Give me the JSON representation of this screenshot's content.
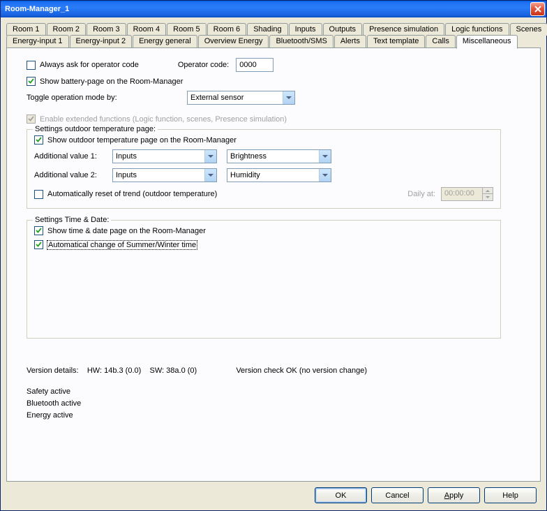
{
  "window": {
    "title": "Room-Manager_1"
  },
  "tabs_row1": [
    {
      "label": "Room 1"
    },
    {
      "label": "Room 2"
    },
    {
      "label": "Room 3"
    },
    {
      "label": "Room 4"
    },
    {
      "label": "Room 5"
    },
    {
      "label": "Room 6"
    },
    {
      "label": "Shading"
    },
    {
      "label": "Inputs"
    },
    {
      "label": "Outputs"
    },
    {
      "label": "Presence simulation"
    },
    {
      "label": "Logic functions"
    },
    {
      "label": "Scenes"
    }
  ],
  "tabs_row2": [
    {
      "label": "Energy-input 1"
    },
    {
      "label": "Energy-input 2"
    },
    {
      "label": "Energy general"
    },
    {
      "label": "Overview Energy"
    },
    {
      "label": "Bluetooth/SMS"
    },
    {
      "label": "Alerts"
    },
    {
      "label": "Text template"
    },
    {
      "label": "Calls"
    },
    {
      "label": "Miscellaneous",
      "active": true
    }
  ],
  "misc": {
    "always_ask_label": "Always ask for operator code",
    "operator_code_label": "Operator code:",
    "operator_code_value": "0000",
    "show_battery_label": "Show battery-page on the Room-Manager",
    "toggle_mode_label": "Toggle operation mode by:",
    "toggle_mode_value": "External sensor",
    "enable_ext_label": "Enable extended functions (Logic function, scenes, Presence simulation)"
  },
  "outdoor": {
    "legend": "Settings outdoor temperature page:",
    "show_label": "Show outdoor temperature page on the Room-Manager",
    "add1_label": "Additional value 1:",
    "add1_src": "Inputs",
    "add1_val": "Brightness",
    "add2_label": "Additional value 2:",
    "add2_src": "Inputs",
    "add2_val": "Humidity",
    "auto_reset_label": "Automatically reset of trend (outdoor temperature)",
    "daily_at_label": "Daily at:",
    "daily_at_value": "00:00:00"
  },
  "timedate": {
    "legend": "Settings Time & Date:",
    "show_label": "Show time & date page on the Room-Manager",
    "auto_summer_label": "Automatical change of Summer/Winter time"
  },
  "status": {
    "version_label": "Version details:",
    "hw": "HW: 14b.3 (0.0)",
    "sw": "SW: 38a.0 (0)",
    "check": "Version check OK (no version change)",
    "lines": [
      "Safety active",
      "Bluetooth active",
      "Energy active"
    ]
  },
  "buttons": {
    "ok": "OK",
    "cancel": "Cancel",
    "apply": "Apply",
    "help": "Help"
  }
}
